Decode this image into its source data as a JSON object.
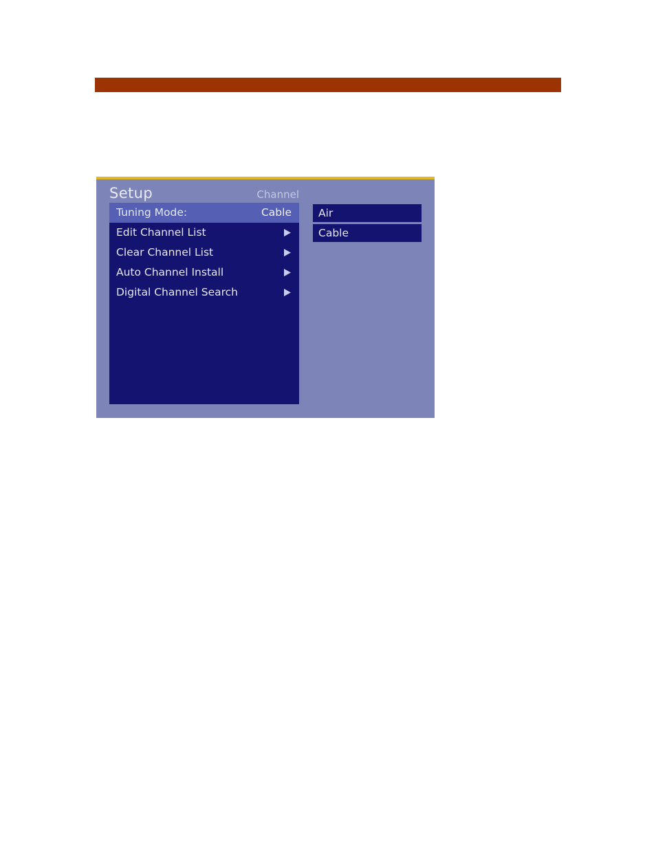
{
  "page": {
    "accent_bar_color": "#9c3302"
  },
  "osd": {
    "title": "Setup",
    "subtitle": "Channel",
    "colors": {
      "panel_bg": "#7d84b8",
      "menu_bg": "#141470",
      "selected_row": "#5560b4",
      "top_rule": "#e0b828",
      "text": "#e6e8f6"
    },
    "menu": {
      "items": [
        {
          "label": "Tuning Mode:",
          "value": "Cable",
          "has_arrow": false,
          "selected": true
        },
        {
          "label": "Edit Channel List",
          "value": "",
          "has_arrow": true,
          "selected": false
        },
        {
          "label": "Clear Channel List",
          "value": "",
          "has_arrow": true,
          "selected": false
        },
        {
          "label": "Auto Channel Install",
          "value": "",
          "has_arrow": true,
          "selected": false
        },
        {
          "label": "Digital Channel Search",
          "value": "",
          "has_arrow": true,
          "selected": false
        }
      ]
    },
    "submenu": {
      "options": [
        {
          "label": "Air"
        },
        {
          "label": "Cable"
        }
      ]
    }
  }
}
